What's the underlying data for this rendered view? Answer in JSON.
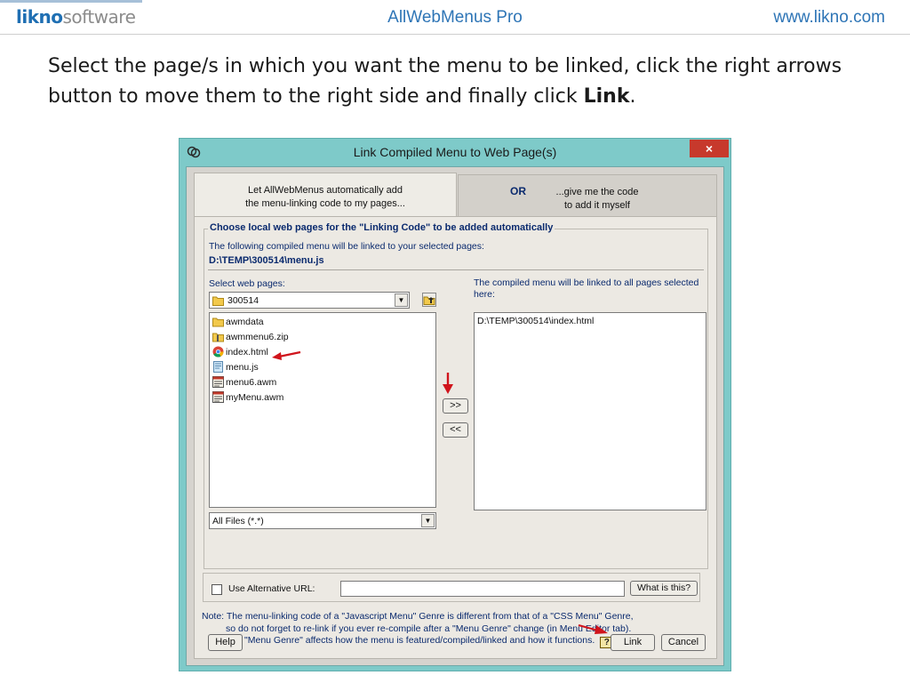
{
  "header": {
    "logo_part1": "likno",
    "logo_part2": "software",
    "title": "AllWebMenus Pro",
    "url": "www.likno.com"
  },
  "instruction": {
    "text": "Select the page/s in which you want the menu to be linked, click the right arrows button to move them to the right side and finally click ",
    "emphasis": "Link",
    "end": "."
  },
  "window": {
    "title": "Link Compiled Menu to Web Page(s)",
    "close_label": "×",
    "tabs": {
      "auto_line1": "Let AllWebMenus automatically add",
      "auto_line2": "the menu-linking code to my pages...",
      "or_label": "OR",
      "manual_line1": "...give me the code",
      "manual_line2": "to add it myself"
    },
    "group": {
      "legend": "Choose local web pages for the \"Linking Code\" to be added automatically",
      "compiled_info": "The following compiled menu will be linked to your selected pages:",
      "compiled_path": "D:\\TEMP\\300514\\menu.js",
      "select_label": "Select web pages:",
      "folder_value": "300514",
      "files": [
        {
          "name": "awmdata",
          "icon": "folder-icon"
        },
        {
          "name": "awmmenu6.zip",
          "icon": "zip-folder-icon"
        },
        {
          "name": "index.html",
          "icon": "chrome-icon"
        },
        {
          "name": "menu.js",
          "icon": "script-file-icon"
        },
        {
          "name": "menu6.awm",
          "icon": "awm-file-icon"
        },
        {
          "name": "myMenu.awm",
          "icon": "awm-file-icon"
        }
      ],
      "filter_value": "All Files (*.*)",
      "right_info_line1": "The compiled menu will be linked to all pages selected",
      "right_info_line2": "here:",
      "selected_pages": [
        "D:\\TEMP\\300514\\index.html"
      ],
      "add_button": ">>",
      "remove_button": "<<"
    },
    "alt_url": {
      "label": "Use Alternative URL:",
      "value": "",
      "what_button": "What is this?"
    },
    "note": {
      "line1": "Note: The menu-linking code of a \"Javascript Menu\" Genre is different from that of a \"CSS Menu\" Genre,",
      "line2": "so do not forget to re-link if you ever re-compile after a \"Menu Genre\" change (in Menu Editor tab).",
      "line3": "The \"Menu Genre\" affects how the menu is featured/compiled/linked and how it functions.",
      "help_label": "?"
    },
    "buttons": {
      "help": "Help",
      "link": "Link",
      "cancel": "Cancel"
    }
  },
  "colors": {
    "window_frame": "#7ecac9",
    "close_button": "#c7392c",
    "header_text": "#2e75b6",
    "annotation_arrow": "#d0141c",
    "label_text": "#0a2a6e"
  }
}
